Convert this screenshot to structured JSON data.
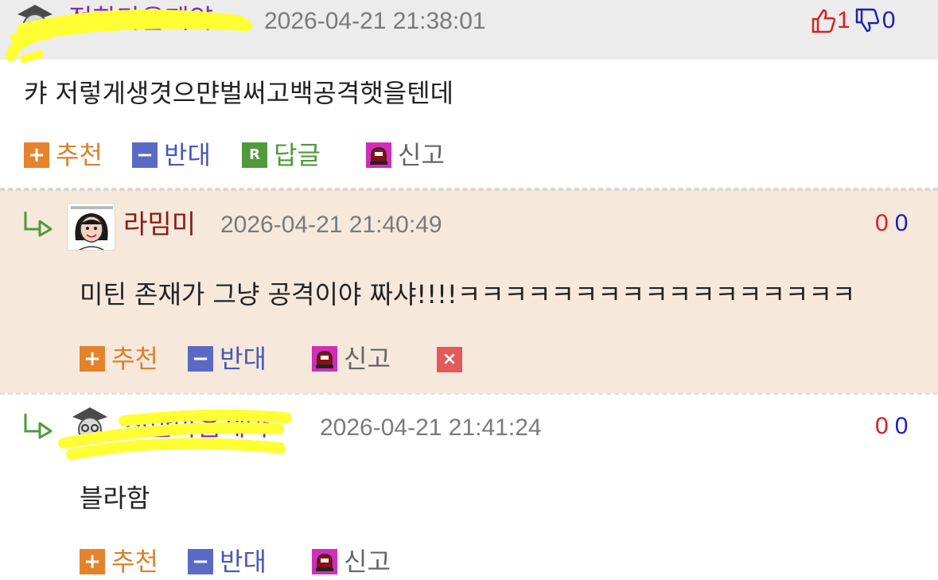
{
  "comments": [
    {
      "nickname": "정한마음제약",
      "datetime": "2026-04-21 21:38:01",
      "up_count": "1",
      "down_count": "0",
      "body": "캬 저렇게생겻으먄벌써고백공격햇을텐데",
      "actions": {
        "recommend": "추천",
        "oppose": "반대",
        "reply": "답글",
        "report": "신고"
      }
    },
    {
      "nickname": "라밈미",
      "datetime": "2026-04-21 21:40:49",
      "up_count": "0",
      "down_count": "0",
      "body": "미틴 존재가 그냥 공격이야 짜샤!!!!ㅋㅋㅋㅋㅋㅋㅋㅋㅋㅋㅋㅋㅋㅋㅋㅋㅋ",
      "actions": {
        "recommend": "추천",
        "oppose": "반대",
        "report": "신고"
      }
    },
    {
      "nickname": "정한마음제약",
      "datetime": "2026-04-21 21:41:24",
      "up_count": "0",
      "down_count": "0",
      "body": "블라함",
      "actions": {
        "recommend": "추천",
        "oppose": "반대",
        "report": "신고"
      }
    }
  ],
  "colors": {
    "nickname_purple": "#8a2aa8",
    "nickname_red": "#8b1a1a",
    "up": "#d82020",
    "down": "#1a22b8",
    "highlight_scribble": "#ffff33",
    "reply_box_bg": "#f6e9dc"
  },
  "icons": [
    "avatar-icon",
    "thumbs-up-icon",
    "thumbs-down-icon",
    "plus-icon",
    "minus-icon",
    "reply-icon",
    "siren-icon",
    "delete-icon",
    "reply-arrow-icon"
  ]
}
